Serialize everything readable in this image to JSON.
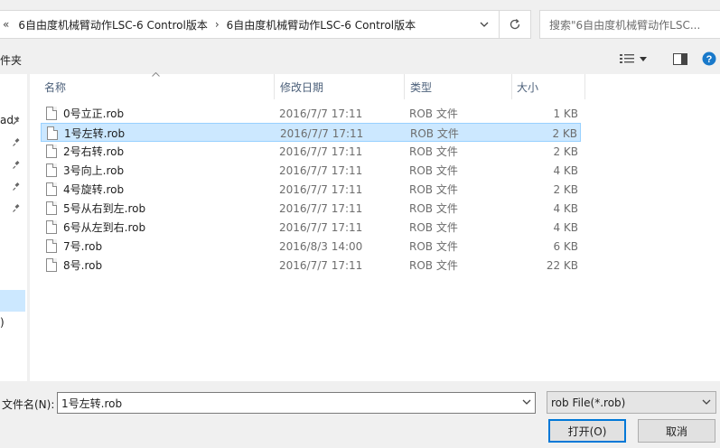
{
  "address": {
    "back_glyph": "«",
    "segments": [
      "6自由度机械臂动作LSC-6 Control版本",
      "6自由度机械臂动作LSC-6 Control版本"
    ],
    "separator": "›"
  },
  "search": {
    "placeholder": "搜索\"6自由度机械臂动作LSC..."
  },
  "toolbar": {
    "left_label": "件夹"
  },
  "nav": {
    "items": [
      "ad",
      "",
      "",
      "",
      ""
    ],
    "bottom_label": ")"
  },
  "columns": {
    "name": "名称",
    "date": "修改日期",
    "type": "类型",
    "size": "大小"
  },
  "files": [
    {
      "name": "0号立正.rob",
      "date": "2016/7/7 17:11",
      "type": "ROB 文件",
      "size": "1 KB",
      "selected": false
    },
    {
      "name": "1号左转.rob",
      "date": "2016/7/7 17:11",
      "type": "ROB 文件",
      "size": "2 KB",
      "selected": true
    },
    {
      "name": "2号右转.rob",
      "date": "2016/7/7 17:11",
      "type": "ROB 文件",
      "size": "2 KB",
      "selected": false
    },
    {
      "name": "3号向上.rob",
      "date": "2016/7/7 17:11",
      "type": "ROB 文件",
      "size": "4 KB",
      "selected": false
    },
    {
      "name": "4号旋转.rob",
      "date": "2016/7/7 17:11",
      "type": "ROB 文件",
      "size": "2 KB",
      "selected": false
    },
    {
      "name": "5号从右到左.rob",
      "date": "2016/7/7 17:11",
      "type": "ROB 文件",
      "size": "4 KB",
      "selected": false
    },
    {
      "name": "6号从左到右.rob",
      "date": "2016/7/7 17:11",
      "type": "ROB 文件",
      "size": "4 KB",
      "selected": false
    },
    {
      "name": "7号.rob",
      "date": "2016/8/3 14:00",
      "type": "ROB 文件",
      "size": "6 KB",
      "selected": false
    },
    {
      "name": "8号.rob",
      "date": "2016/7/7 17:11",
      "type": "ROB 文件",
      "size": "22 KB",
      "selected": false
    }
  ],
  "footer": {
    "filename_label": "文件名(N):",
    "filename_value": "1号左转.rob",
    "filetype_value": "rob File(*.rob)",
    "open_label": "打开(O)",
    "cancel_label": "取消"
  },
  "colors": {
    "selection": "#cce8ff",
    "selection_border": "#99d1ff",
    "accent": "#0078d7",
    "help": "#1979ca"
  }
}
